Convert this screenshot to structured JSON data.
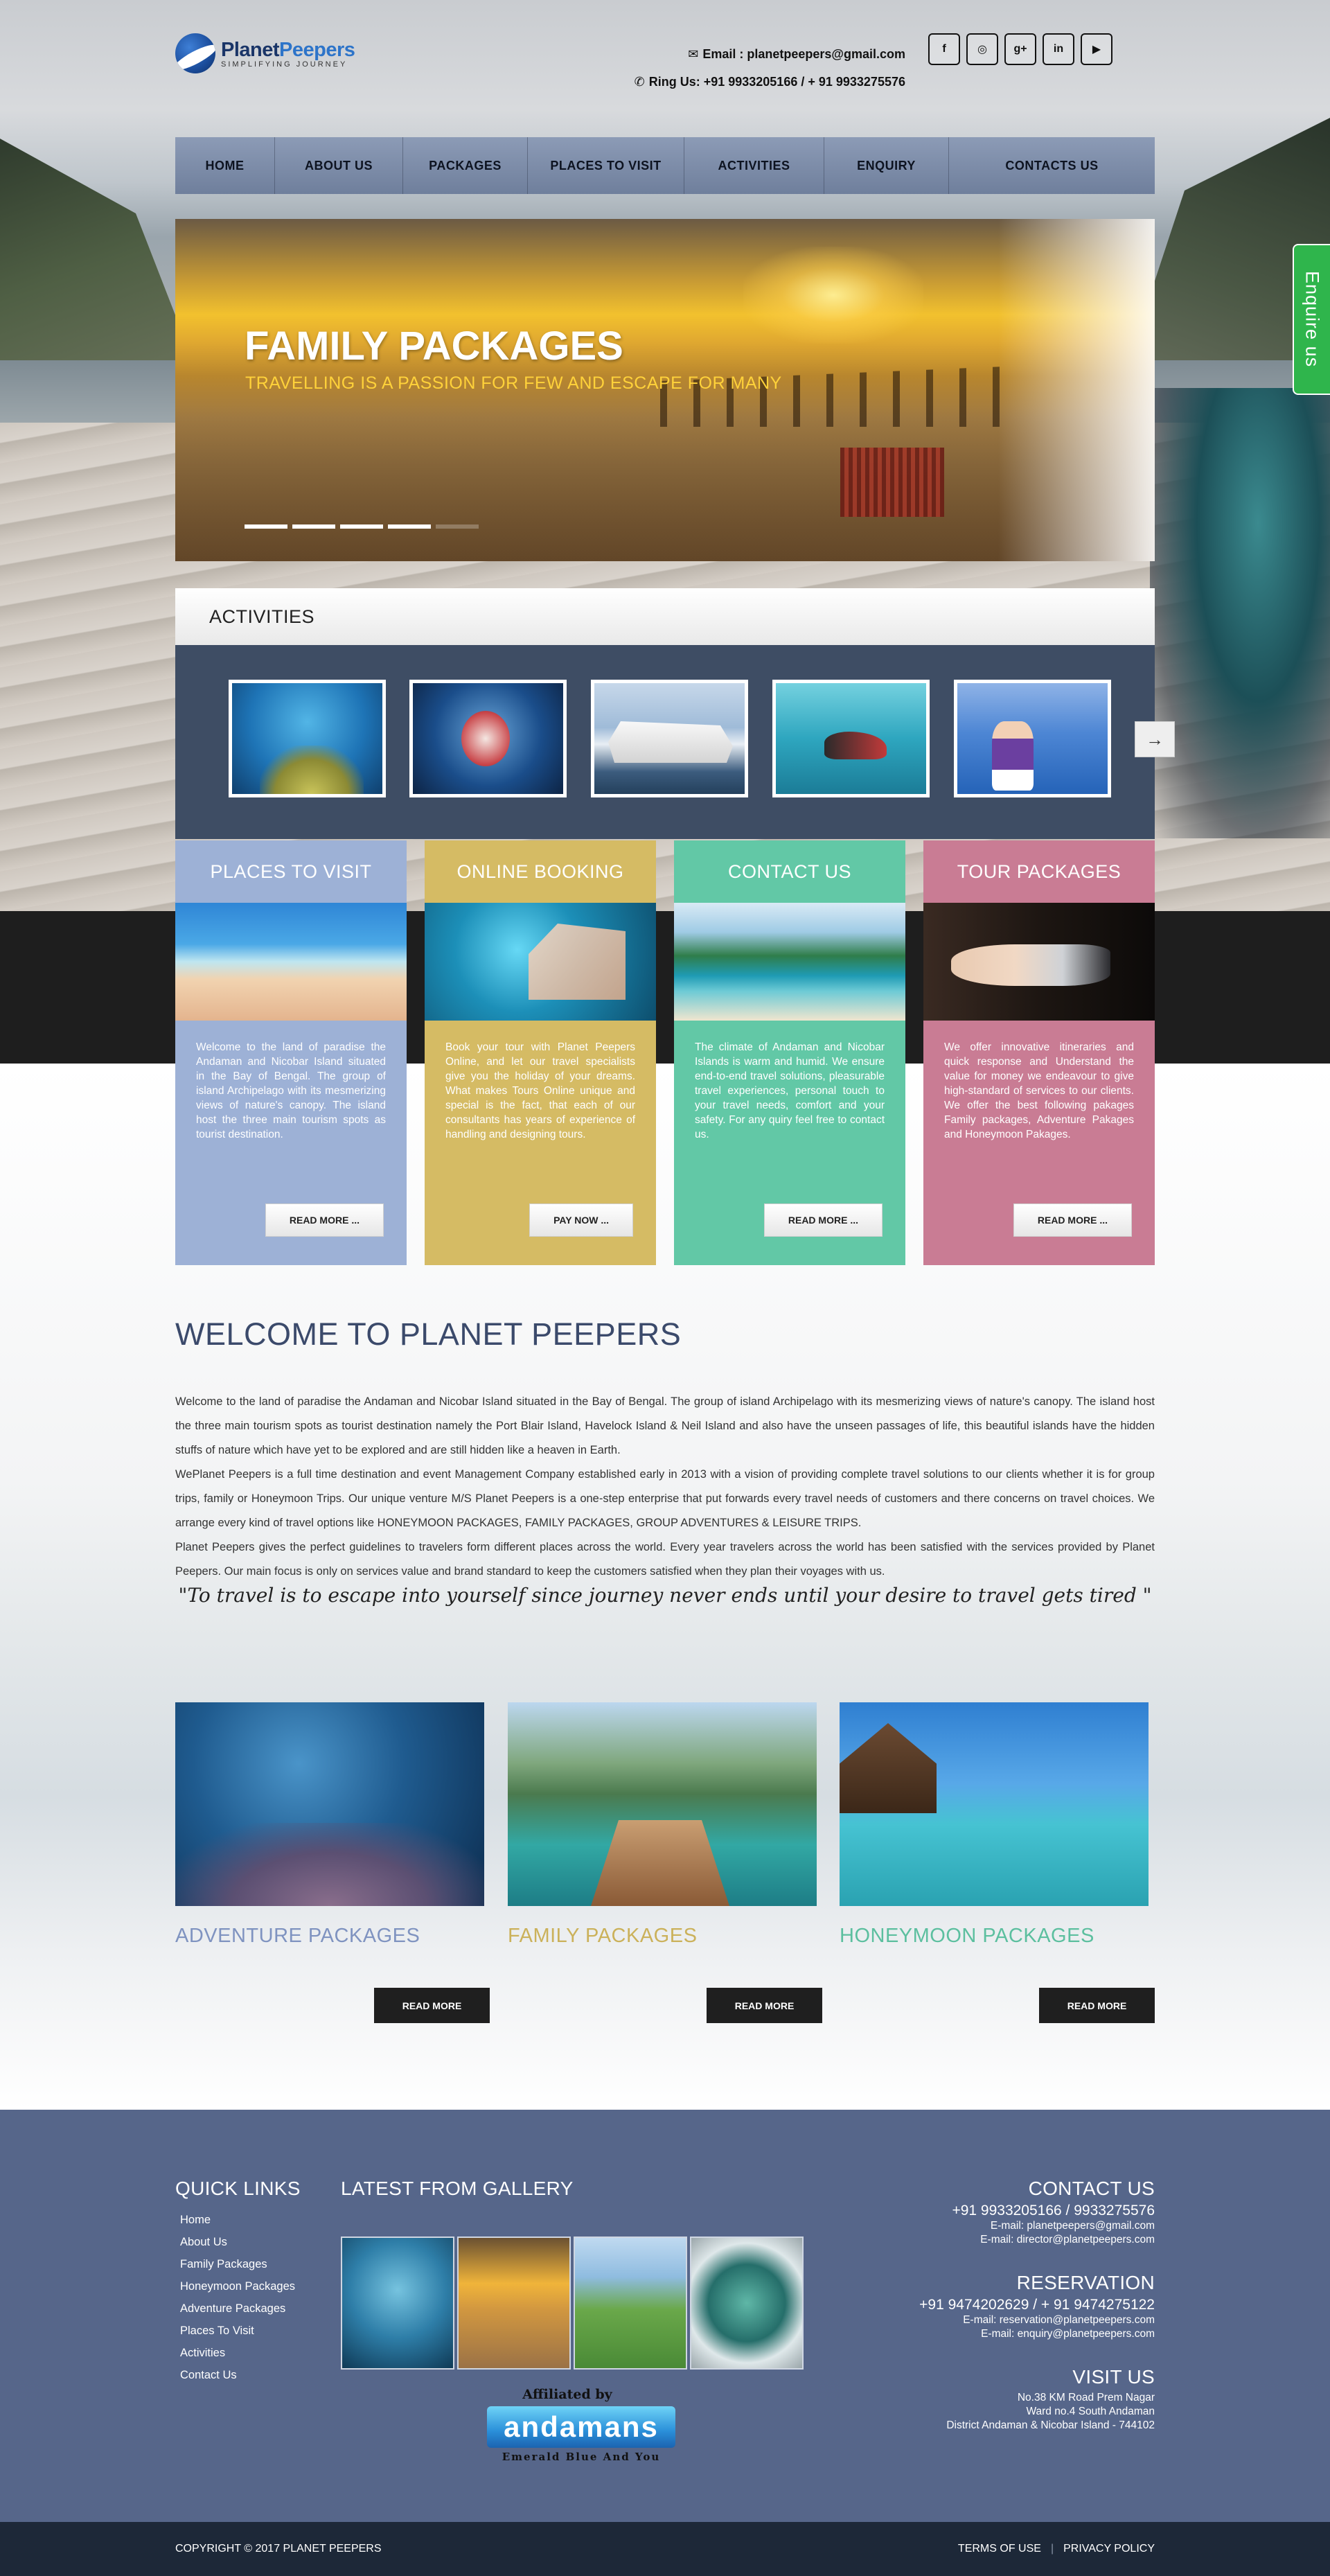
{
  "header": {
    "brand_first": "Planet",
    "brand_second": "Peepers",
    "tagline": "SIMPLIFYING JOURNEY",
    "email_label": "Email : planetpeepers@gmail.com",
    "phone_label": "Ring Us: +91 9933205166 / + 91 9933275576",
    "social": [
      "f",
      "◎",
      "g+",
      "in",
      "▶"
    ]
  },
  "nav": [
    "HOME",
    "ABOUT US",
    "PACKAGES",
    "PLACES TO VISIT",
    "ACTIVITIES",
    "ENQUIRY",
    "CONTACTS US"
  ],
  "enquire": "Enquire us",
  "slider": {
    "title": "FAMILY PACKAGES",
    "subtitle": "TRAVELLING IS A PASSION FOR FEW AND ESCAPE FOR MANY"
  },
  "activities": {
    "heading": "ACTIVITIES",
    "next_arrow": "→"
  },
  "cards": [
    {
      "title": "PLACES TO VISIT",
      "text": "Welcome to the land of paradise the Andaman and Nicobar Island situated in the Bay of Bengal. The group of island Archipelago with its mesmerizing views of nature's canopy. The island host the three main tourism spots as tourist destination.",
      "button": "READ MORE ..."
    },
    {
      "title": "ONLINE BOOKING",
      "text": "Book your tour with Planet Peepers Online, and let our travel specialists give you the holiday of your dreams. What makes Tours Online unique and special is the fact, that each of our consultants has years of experience of handling and designing tours.",
      "button": "PAY NOW ..."
    },
    {
      "title": "CONTACT US",
      "text": "The climate of Andaman and Nicobar Islands is warm and humid. We ensure end-to-end travel solutions, pleasurable travel experiences, personal touch to your travel needs, comfort and your safety. For any quiry feel free to contact us.",
      "button": "READ MORE ..."
    },
    {
      "title": "TOUR PACKAGES",
      "text": "We offer innovative itineraries and quick response and Understand the value for money we endeavour to give high-standard of services to our clients. We offer the best following pakages Family packages, Adventure Pakages and Honeymoon Pakages.",
      "button": "READ MORE ..."
    }
  ],
  "welcome": {
    "title": "WELCOME TO PLANET PEEPERS",
    "p1": "Welcome to the land of paradise the Andaman and Nicobar Island situated in the Bay of Bengal. The group of island Archipelago with its mesmerizing views of nature's canopy. The island host the three main tourism spots as tourist destination namely the Port Blair Island, Havelock Island & Neil Island and also have the unseen passages of life, this beautiful islands have the hidden stuffs of nature which have yet to be explored and are still hidden like a heaven in Earth.",
    "p2": "WePlanet Peepers is a full time destination and event Management Company established early in 2013 with a vision of providing complete travel solutions to our clients whether it is for group trips, family or Honeymoon Trips. Our unique venture M/S Planet Peepers is a one-step enterprise that put forwards every travel needs of customers and there concerns on travel choices. We arrange every kind of travel options like HONEYMOON PACKAGES, FAMILY PACKAGES, GROUP ADVENTURES & LEISURE TRIPS.",
    "p3": "Planet Peepers gives the perfect guidelines to travelers form different places across the world. Every year travelers across the world has been satisfied with the services provided by Planet Peepers. Our main focus is only on services value and brand standard to keep the customers satisfied when they plan their voyages with us.",
    "quote": "\"To travel is to escape into yourself since journey never ends until your desire to travel gets tired \""
  },
  "packages": [
    {
      "title": "ADVENTURE PACKAGES",
      "button": "READ MORE",
      "color": "#7f93c0"
    },
    {
      "title": "FAMILY PACKAGES",
      "button": "READ MORE",
      "color": "#cbb15a"
    },
    {
      "title": "HONEYMOON PACKAGES",
      "button": "READ MORE",
      "color": "#5cbf9f"
    }
  ],
  "footer": {
    "quick_links_title": "QUICK LINKS",
    "quick_links": [
      "Home",
      "About Us",
      "Family Packages",
      "Honeymoon Packages",
      "Adventure Packages",
      "Places To Visit",
      "Activities",
      "Contact Us"
    ],
    "gallery_title": "LATEST FROM GALLERY",
    "affiliated_by": "Affiliated by",
    "affiliate_name": "andamans",
    "affiliate_tagline": "Emerald Blue And You",
    "contact_title": "CONTACT US",
    "contact_phone": "+91 9933205166 / 9933275576",
    "contact_email1": "E-mail: planetpeepers@gmail.com",
    "contact_email2": "E-mail: director@planetpeepers.com",
    "reservation_title": "RESERVATION",
    "reservation_phone": "+91 9474202629 / + 91 9474275122",
    "reservation_email1": "E-mail: reservation@planetpeepers.com",
    "reservation_email2": "E-mail: enquiry@planetpeepers.com",
    "visit_title": "VISIT US",
    "address1": "No.38 KM Road Prem Nagar",
    "address2": "Ward no.4 South Andaman",
    "address3": "District Andaman & Nicobar Island - 744102"
  },
  "bottom": {
    "copyright": "COPYRIGHT © 2017 PLANET PEEPERS",
    "terms": "TERMS OF USE",
    "separator": "|",
    "privacy": "PRIVACY POLICY"
  },
  "colors": {
    "nav": "#7a89a6",
    "places": "#9db1d6",
    "online": "#d5bb64",
    "contact": "#62c8a6",
    "tour": "#c97c94",
    "footer": "#56668a",
    "enquire": "#2fb54c"
  }
}
